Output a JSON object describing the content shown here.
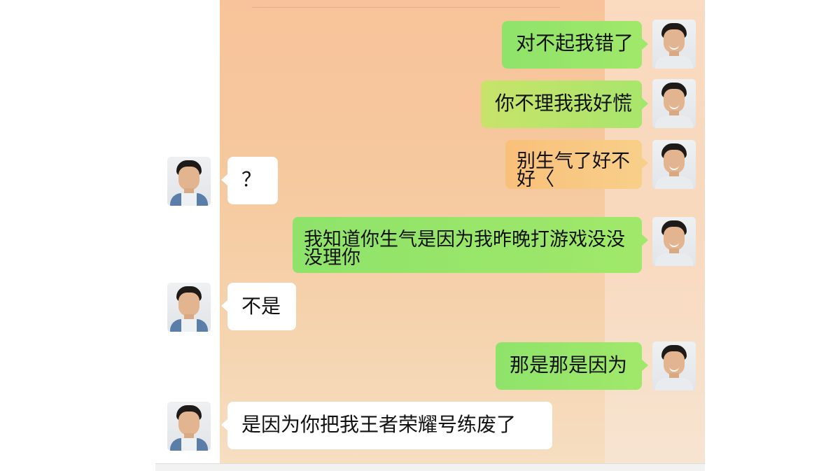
{
  "messages": [
    {
      "side": "right",
      "text": "对不起我错了"
    },
    {
      "side": "right",
      "text": "你不理我我好慌"
    },
    {
      "side": "right",
      "text": "别生气了好不好〈"
    },
    {
      "side": "left",
      "text": "？"
    },
    {
      "side": "right",
      "text": "我知道你生气是因为我昨晚打游戏没没没理你"
    },
    {
      "side": "left",
      "text": "不是"
    },
    {
      "side": "right",
      "text": "那是那是因为"
    },
    {
      "side": "left",
      "text": "是因为你把我王者荣耀号练废了"
    }
  ],
  "avatars": {
    "self": "self-avatar-photo",
    "other": "contact-avatar-photo"
  },
  "colors": {
    "right_bubble": "#9ee86a",
    "left_bubble": "#ffffff",
    "chat_background": "#f7c8a0"
  }
}
